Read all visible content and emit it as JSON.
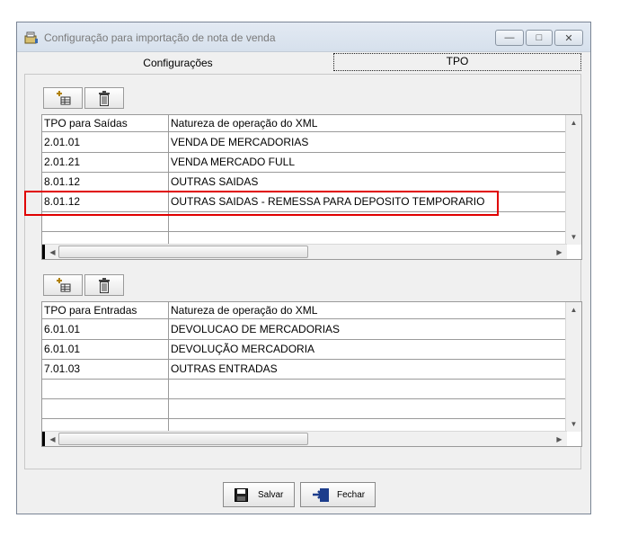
{
  "window": {
    "title": "Configuração para importação de nota de venda",
    "controls": [
      "minimize-icon",
      "restore-icon",
      "close-icon"
    ]
  },
  "tabs": [
    {
      "label": "Configurações"
    },
    {
      "label": "TPO"
    }
  ],
  "toolbar_icons": [
    "add-grid-icon",
    "trash-icon"
  ],
  "saidas": {
    "headers": [
      "TPO para Saídas",
      "Natureza de operação do XML"
    ],
    "rows": [
      {
        "tpo": "2.01.01",
        "natureza": "VENDA DE MERCADORIAS"
      },
      {
        "tpo": "2.01.21",
        "natureza": "VENDA MERCADO FULL"
      },
      {
        "tpo": "8.01.12",
        "natureza": "OUTRAS SAIDAS"
      },
      {
        "tpo": "8.01.12",
        "natureza": "OUTRAS SAIDAS - REMESSA PARA DEPOSITO TEMPORARIO"
      },
      {
        "tpo": "",
        "natureza": ""
      }
    ]
  },
  "entradas": {
    "headers": [
      "TPO para Entradas",
      "Natureza de operação do XML"
    ],
    "rows": [
      {
        "tpo": "6.01.01",
        "natureza": "DEVOLUCAO DE MERCADORIAS"
      },
      {
        "tpo": "6.01.01",
        "natureza": "DEVOLUÇÃO MERCADORIA"
      },
      {
        "tpo": "7.01.03",
        "natureza": "OUTRAS ENTRADAS"
      },
      {
        "tpo": "",
        "natureza": ""
      },
      {
        "tpo": "",
        "natureza": ""
      }
    ]
  },
  "footer": {
    "save_label": "Salvar",
    "close_label": "Fechar"
  },
  "colors": {
    "highlight": "#e00000"
  }
}
